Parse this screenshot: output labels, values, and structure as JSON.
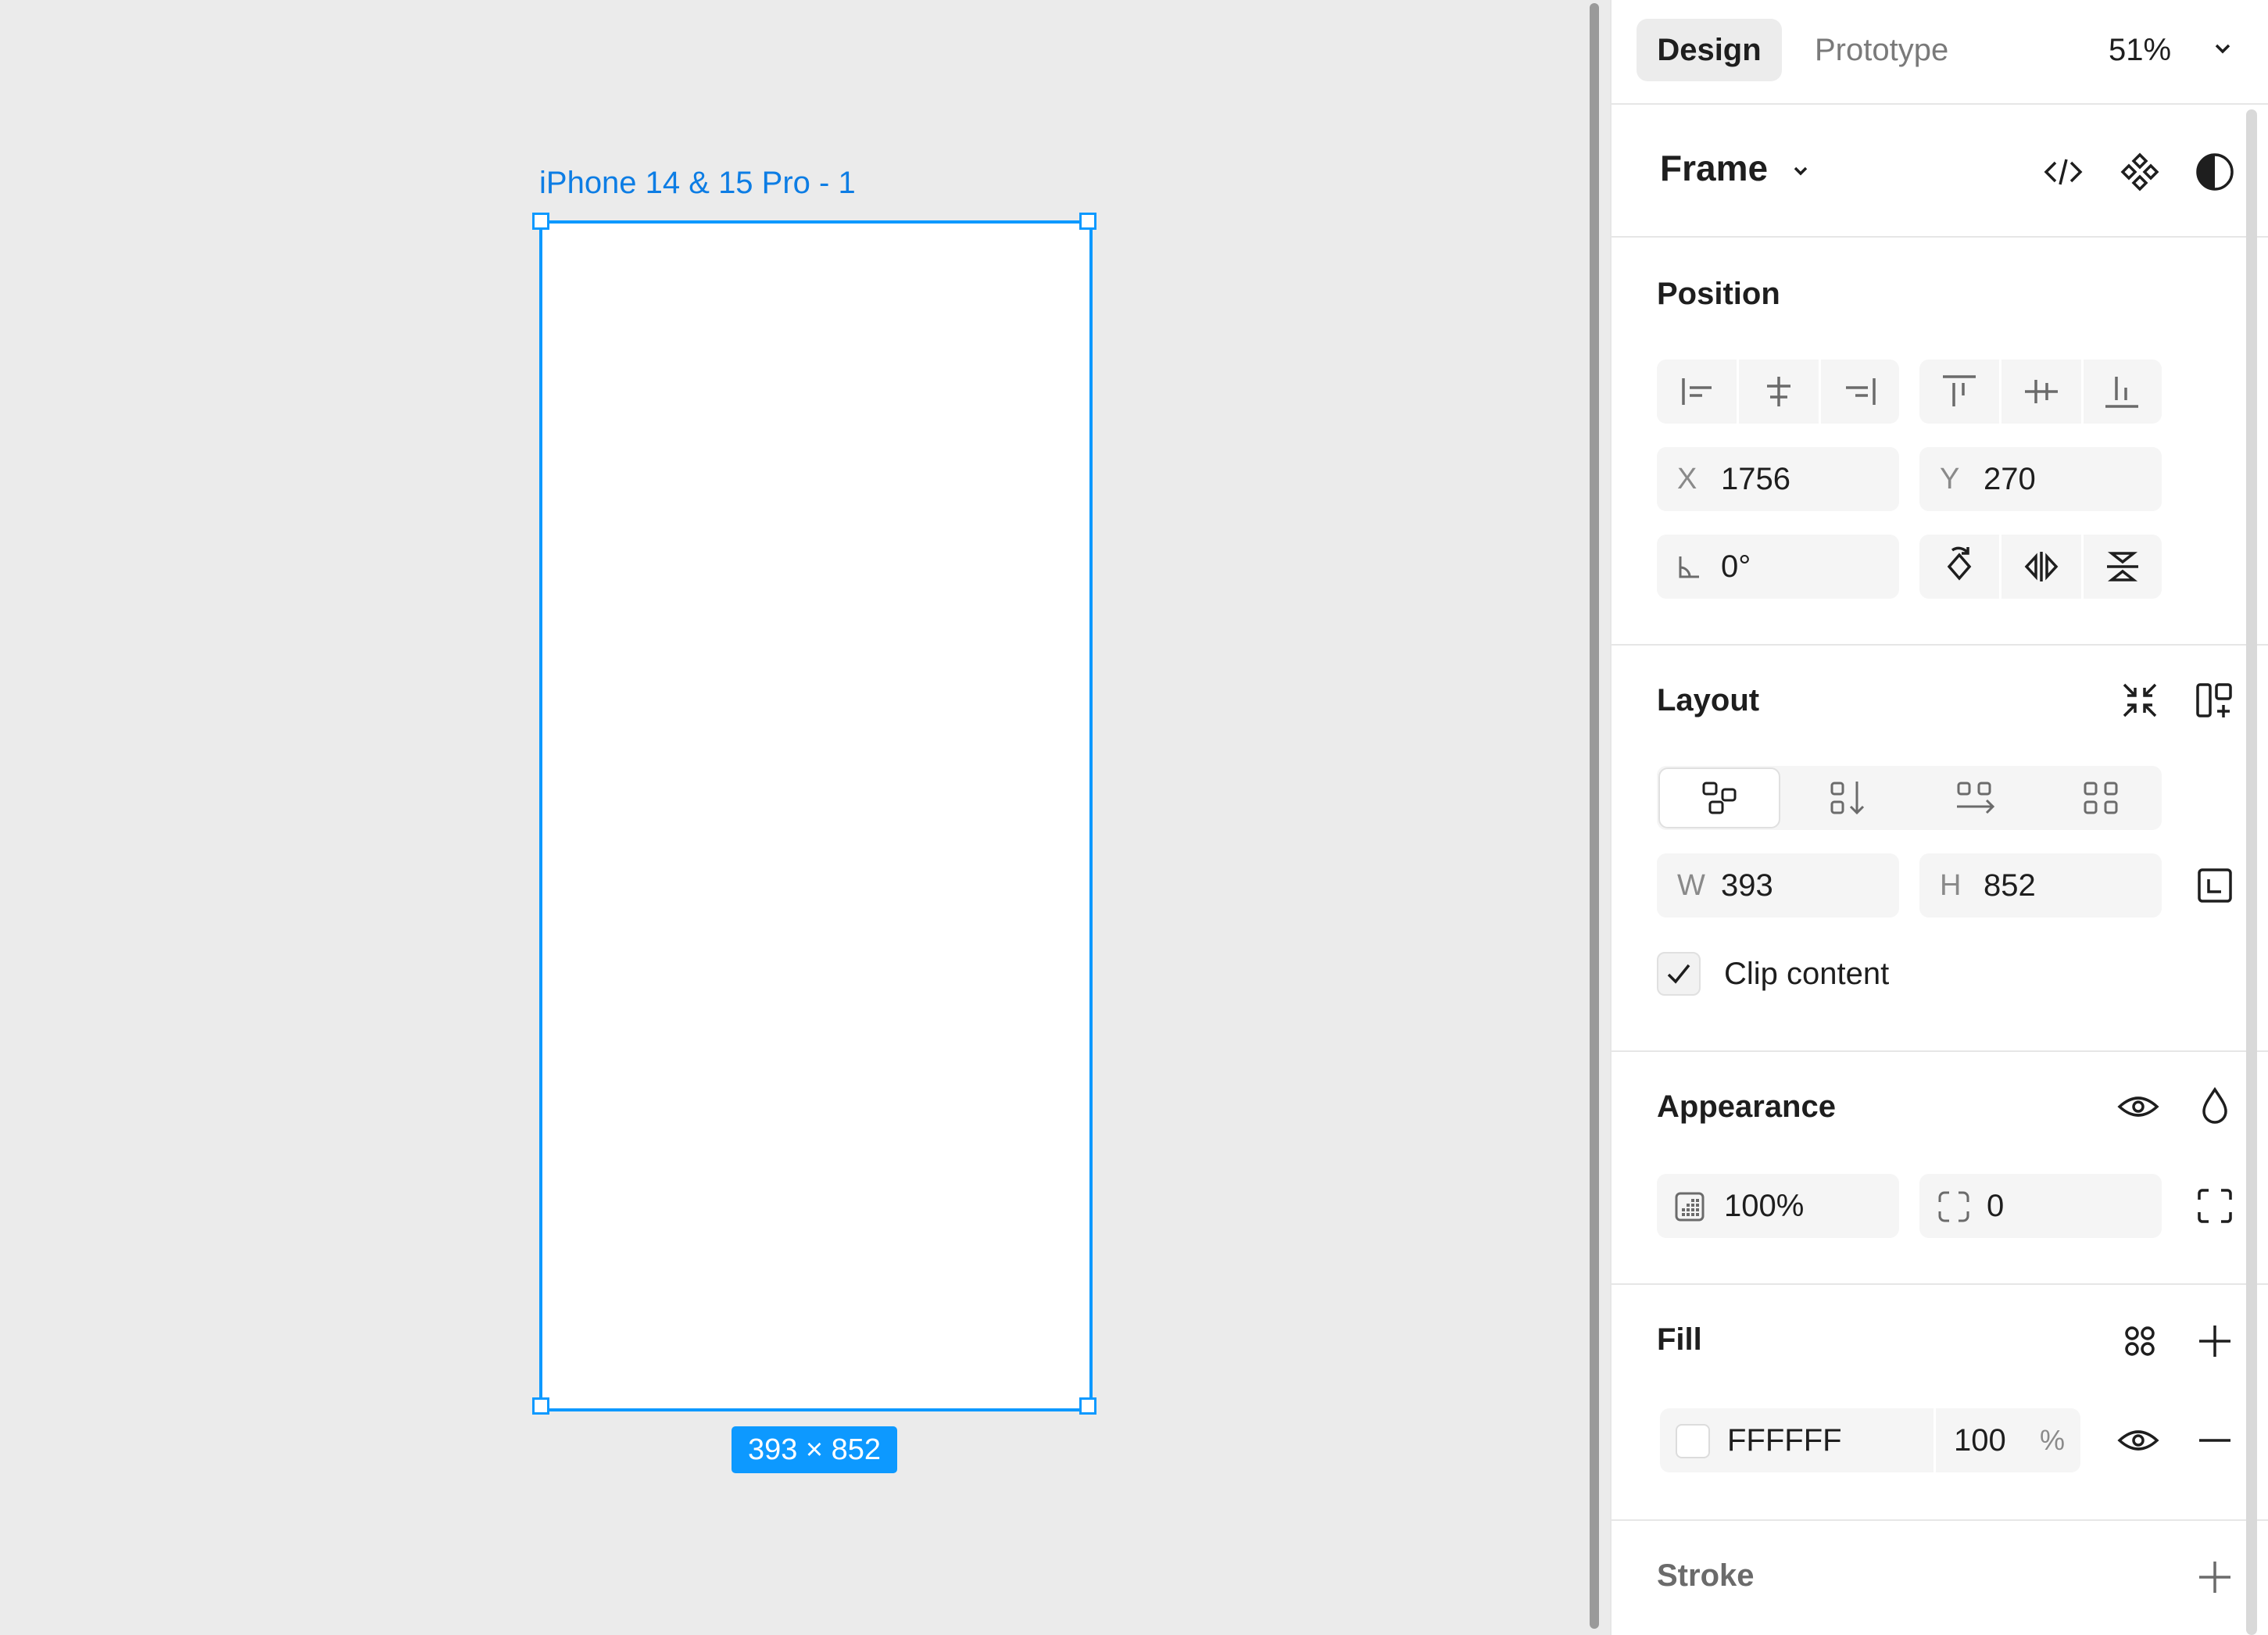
{
  "canvas": {
    "frame_label": "iPhone 14 & 15 Pro - 1",
    "dimensions_badge": "393 × 852"
  },
  "panel": {
    "tabs": [
      {
        "label": "Design",
        "active": true
      },
      {
        "label": "Prototype",
        "active": false
      }
    ],
    "zoom": "51%",
    "frame_section": {
      "title": "Frame"
    },
    "position": {
      "title": "Position",
      "x_label": "X",
      "x_value": "1756",
      "y_label": "Y",
      "y_value": "270",
      "rotation": "0°"
    },
    "layout": {
      "title": "Layout",
      "w_label": "W",
      "w_value": "393",
      "h_label": "H",
      "h_value": "852",
      "clip_content_label": "Clip content",
      "clip_content_checked": true
    },
    "appearance": {
      "title": "Appearance",
      "opacity": "100%",
      "corner_radius": "0"
    },
    "fill": {
      "title": "Fill",
      "hex": "FFFFFF",
      "opacity": "100",
      "percent_sign": "%",
      "swatch_color": "#ffffff"
    },
    "stroke": {
      "title": "Stroke"
    }
  },
  "colors": {
    "selection": "#0d99ff",
    "label": "#0d7de4",
    "canvas_bg": "#ebebeb",
    "panel_bg": "#ffffff"
  }
}
